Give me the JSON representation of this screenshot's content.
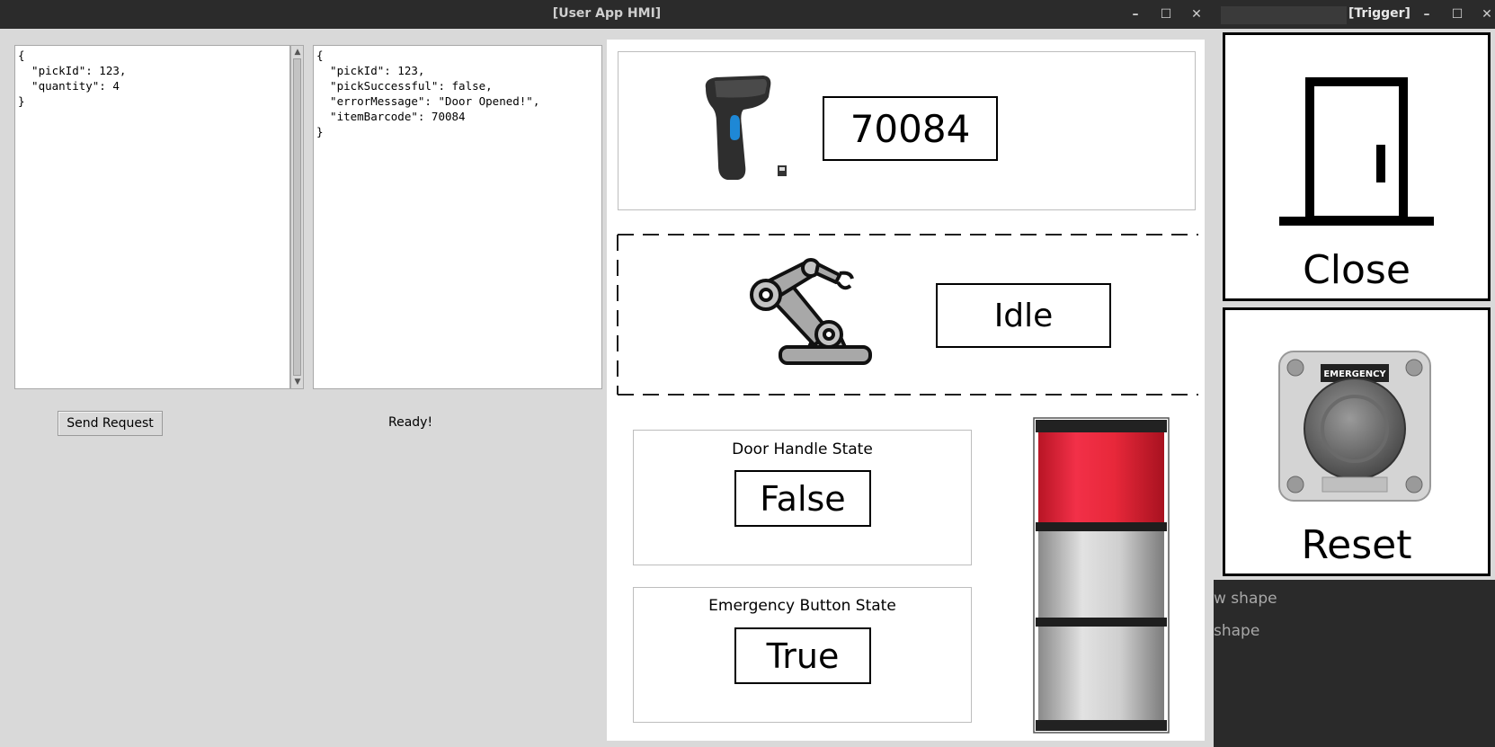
{
  "main_window": {
    "title": "[User App HMI]",
    "controls": {
      "minimize": "–",
      "maximize": "☐",
      "close": "✕"
    },
    "request_json": "{\n  \"pickId\": 123,\n  \"quantity\": 4\n}",
    "response_json": "{\n  \"pickId\": 123,\n  \"pickSuccessful\": false,\n  \"errorMessage\": \"Door Opened!\",\n  \"itemBarcode\": 70084\n}",
    "send_button_label": "Send Request",
    "status_text": "Ready!",
    "scanner_value": "70084",
    "robot_state": "Idle",
    "door_handle": {
      "label": "Door Handle State",
      "value": "False"
    },
    "emergency_button": {
      "label": "Emergency Button State",
      "value": "True"
    },
    "stack_light": {
      "red": "#e8283a",
      "off": "#d0d0d0",
      "active": "red"
    }
  },
  "trigger_window": {
    "title": "[Trigger]",
    "controls": {
      "minimize": "–",
      "maximize": "☐",
      "close": "✕"
    },
    "close_label": "Close",
    "reset_label": "Reset",
    "estop_plate_text": "EMERGENCY"
  },
  "background_window": {
    "line1": "w shape",
    "line2": " shape"
  }
}
